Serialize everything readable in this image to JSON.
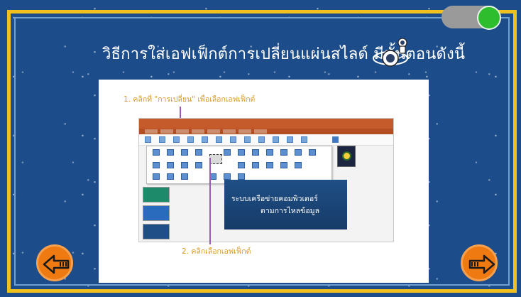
{
  "title": "วิธีการใส่เอฟเฟ็กต์การเปลี่ยนแผ่นสไลด์ มีขั้นตอนดังนี้",
  "callouts": {
    "step1": "1. คลิกที่ \"การเปลี่ยน\" เพื่อเลือกเอฟเฟ็กต์",
    "step2": "2. คลิกเลือกเอฟเฟ็กต์"
  },
  "embedded_slide": {
    "line1": "ระบบเครือข่ายคอมพิวเตอร์",
    "line2": "ตามการไหลข้อมูล"
  },
  "toggle": {
    "state": "on"
  },
  "navigation": {
    "prev_icon": "left-arrow-icon",
    "next_icon": "right-arrow-icon"
  },
  "colors": {
    "background": "#1c4c8a",
    "frame": "#f2c01c",
    "nav_button": "#f07a12",
    "toggle_on": "#2dbd2d",
    "callout_text": "#d79a22",
    "pointer_line": "#9b59b6"
  }
}
